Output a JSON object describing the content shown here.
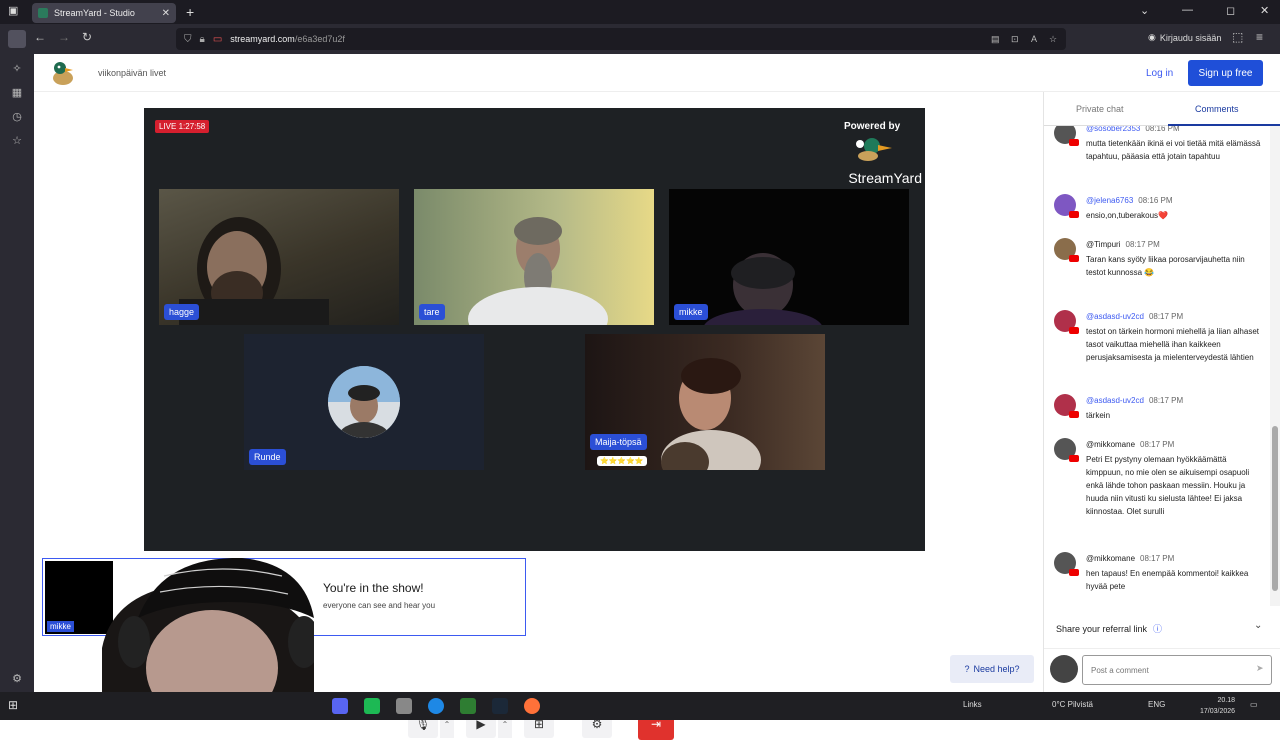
{
  "browser": {
    "tab_title": "StreamYard - Studio",
    "new_tab": "+",
    "url_host": "streamyard.com",
    "url_path": "/e6a3ed7u2f",
    "signin_label": "Kirjaudu sisään"
  },
  "app": {
    "broadcast_title": "viikonpäivän livet",
    "login_label": "Log in",
    "signup_label": "Sign up free"
  },
  "stage": {
    "live_label": "LIVE 1:27:58",
    "powered_by": "Powered by",
    "brand_word": "StreamYard",
    "participants": [
      {
        "name": "hagge"
      },
      {
        "name": "tare"
      },
      {
        "name": "mikke"
      },
      {
        "name": "Runde"
      },
      {
        "name": "Maija-töpsä",
        "badge": "⭐⭐⭐⭐⭐"
      }
    ]
  },
  "self_view": {
    "name": "mikke",
    "title": "You're in the show!",
    "subtitle": "everyone can see and hear you"
  },
  "controls": {
    "help_label": "Need help?"
  },
  "chat": {
    "tabs": [
      "Private chat",
      "Comments"
    ],
    "active_tab": 1,
    "comments": [
      {
        "author": "@sosober2353",
        "time": "08:16 PM",
        "text": "mutta tietenkään ikinä ei voi tietää mitä elämässä tapahtuu, pääasia että jotain tapahtuu",
        "avatar_color": "#555555"
      },
      {
        "author": "@jelena6763",
        "time": "08:16 PM",
        "text": "ensio,on,tuberakous❤️",
        "avatar_color": "#7e57c2"
      },
      {
        "author": "@Timpuri",
        "time": "08:17 PM",
        "text": "Taran kans syöty liikaa porosarvijauhetta niin testot kunnossa 😂",
        "avatar_color": "#8a6d4b"
      },
      {
        "author": "@asdasd-uv2cd",
        "time": "08:17 PM",
        "text": "testot on tärkein hormoni miehellä ja liian alhaset tasot vaikuttaa miehellä ihan kaikkeen perusjaksamisesta ja mielenterveydestä lähtien",
        "avatar_color": "#b0304a"
      },
      {
        "author": "@asdasd-uv2cd",
        "time": "08:17 PM",
        "text": "tärkein",
        "avatar_color": "#b0304a"
      },
      {
        "author": "@mikkomane",
        "time": "08:17 PM",
        "text": "Petri Et pystyny olemaan hyökkäämättä kimppuun, no mie olen se aikuisempi osapuoli enkä lähde tohon paskaan messiin. Houku ja huuda niin vitusti ku sielusta lähtee! Ei jaksa kiinnostaa. Olet surulli",
        "avatar_color": "#555555"
      },
      {
        "author": "@mikkomane",
        "time": "08:17 PM",
        "text": "hen tapaus! En enempää kommentoi! kaikkea hyvää pete",
        "avatar_color": "#555555"
      }
    ],
    "referral_label": "Share your referral link",
    "input_placeholder": "Post a comment"
  },
  "taskbar": {
    "links_label": "Links",
    "weather": "0°C Pilvistä",
    "lang": "ENG",
    "time": "20.18",
    "date": "17/03/2026"
  }
}
